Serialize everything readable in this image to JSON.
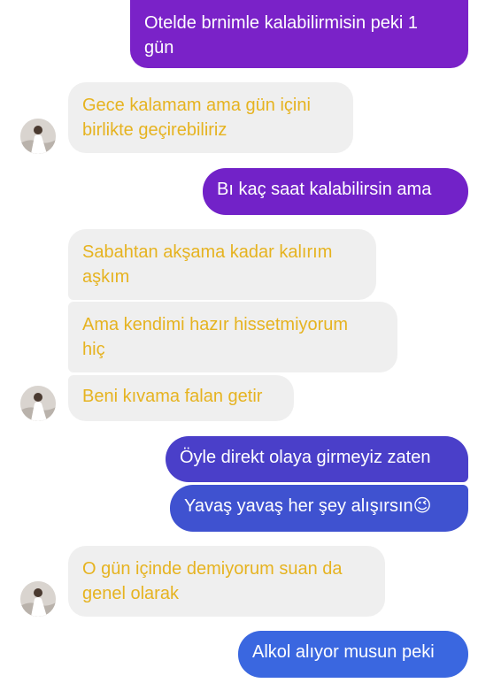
{
  "conversation": {
    "messages": [
      {
        "side": "out",
        "text": "Otelde brnimle kalabilirmisin peki 1\ngün",
        "color": "#7a22c8"
      },
      {
        "side": "in",
        "text": "Gece kalamam ama gün içini\nbirlikte geçirebiliriz"
      },
      {
        "side": "out",
        "text": "Bı kaç saat kalabilirsin ama",
        "color": "#7222c8"
      },
      {
        "side": "in",
        "text": "Sabahtan akşama kadar kalırım\naşkım"
      },
      {
        "side": "in",
        "text": "Ama kendimi hazır hissetmiyorum\nhiç"
      },
      {
        "side": "in",
        "text": "Beni kıvama falan getir"
      },
      {
        "side": "out",
        "text": "Öyle direkt olaya girmeyiz zaten",
        "color": "#4a3fc9"
      },
      {
        "side": "out",
        "text": "Yavaş yavaş her şey alışırsın😉",
        "color": "#3f52d0"
      },
      {
        "side": "in",
        "text": "O gün içinde demiyorum suan da\ngenel olarak"
      },
      {
        "side": "out",
        "text": "Alkol alıyor musun peki",
        "color": "#3a67e0"
      }
    ]
  },
  "colors": {
    "incoming_bubble": "#efefef",
    "incoming_text": "#e6b320",
    "outgoing_text": "#ffffff"
  }
}
